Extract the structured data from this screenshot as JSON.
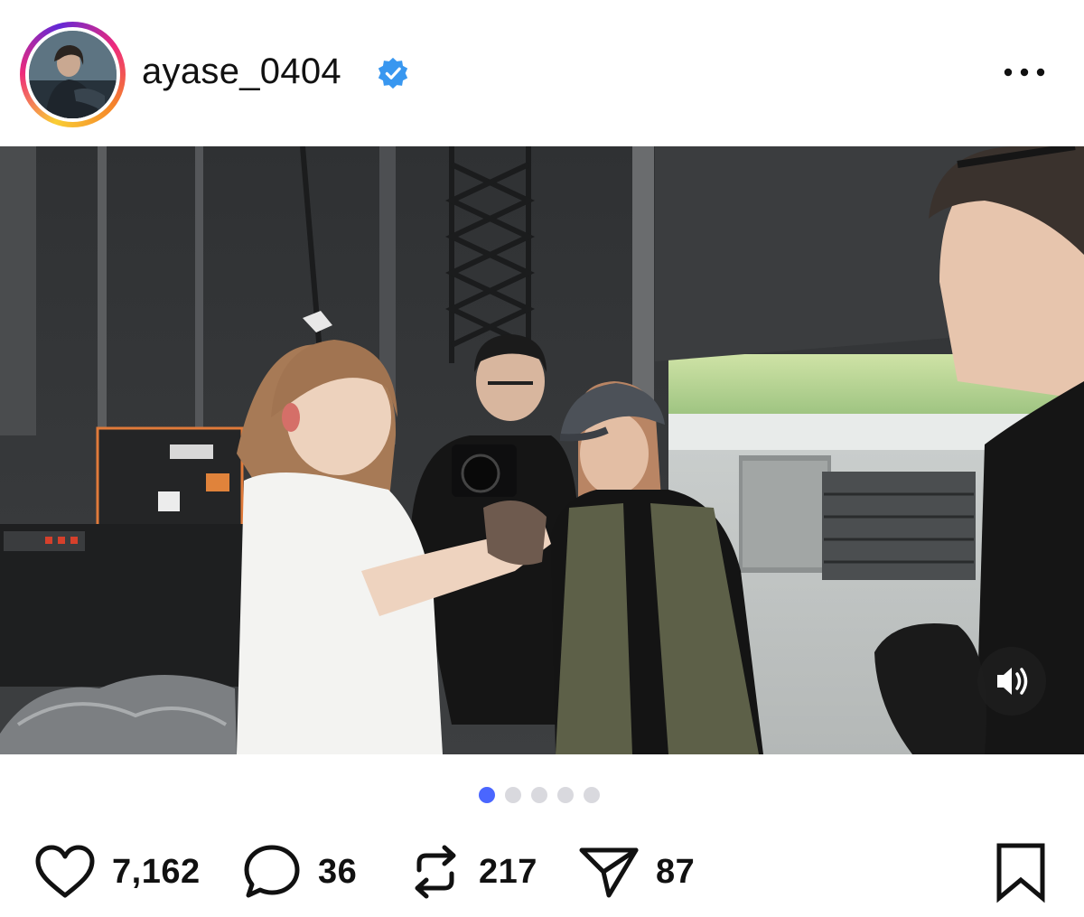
{
  "post": {
    "username": "ayase_0404",
    "verified": true,
    "accent_color": "#3897f0",
    "more_icon": "ellipsis-icon",
    "media_icon": "speaker-icon",
    "carousel": {
      "total": 5,
      "active": 1
    },
    "actions": {
      "likes": "7,162",
      "comments": "36",
      "reposts": "217",
      "shares": "87"
    }
  }
}
